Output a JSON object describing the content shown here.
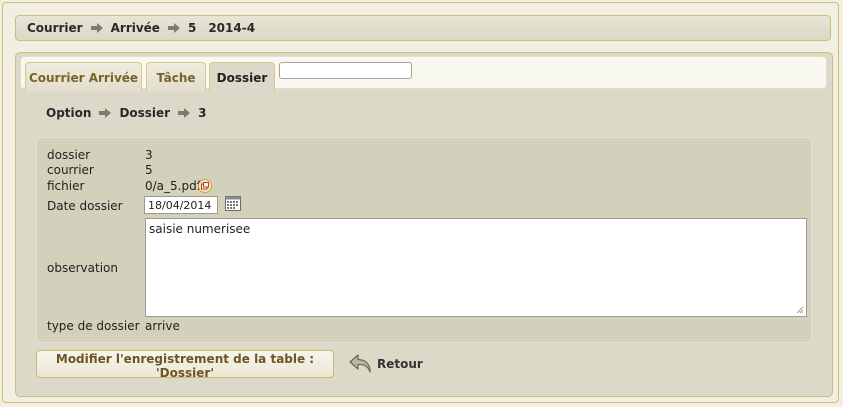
{
  "breadcrumb": {
    "items": [
      "Courrier",
      "Arrivée",
      "5"
    ],
    "ref": "2014-4"
  },
  "tabs": [
    {
      "label": "Courrier Arrivée"
    },
    {
      "label": "Tâche"
    },
    {
      "label": "Dossier"
    }
  ],
  "tab_search": {
    "value": ""
  },
  "sub_breadcrumb": {
    "items": [
      "Option",
      "Dossier",
      "3"
    ]
  },
  "form": {
    "dossier_label": "dossier",
    "dossier_value": "3",
    "courrier_label": "courrier",
    "courrier_value": "5",
    "fichier_label": "fichier",
    "fichier_value": "0/a_5.pdf",
    "date_label": "Date dossier",
    "date_value": "18/04/2014",
    "observation_label": "observation",
    "observation_value": "saisie numerisee",
    "type_label": "type de dossier",
    "type_value": "arrive"
  },
  "actions": {
    "modify_label": "Modifier l'enregistrement de la table : 'Dossier'",
    "retour_label": "Retour"
  },
  "icons": {
    "breadcrumb_arrow": "arrow-right-icon",
    "file_link": "external-link-icon",
    "calendar": "calendar-icon",
    "back": "undo-arrow-icon"
  },
  "colors": {
    "background": "#f3f0e2",
    "panel": "#dcd9c8",
    "form": "#d3d0bc",
    "border": "#cfbe7a",
    "tab_text": "#7a6228"
  }
}
